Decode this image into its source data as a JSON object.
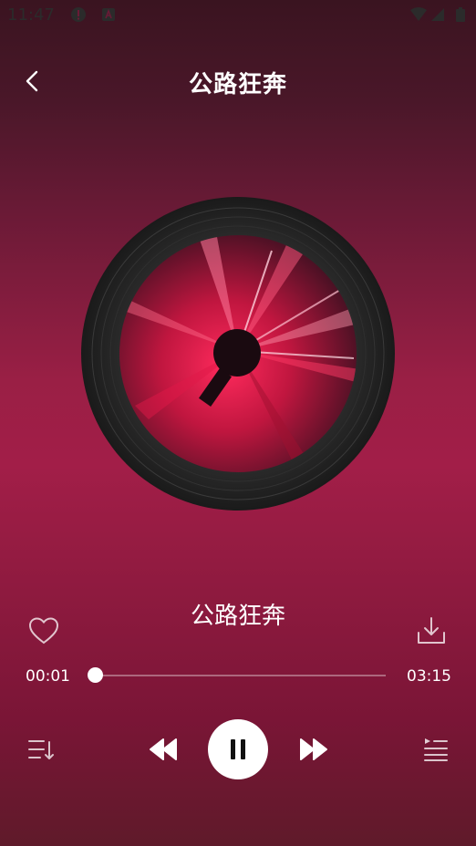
{
  "status_bar": {
    "time": "11:47"
  },
  "header": {
    "title": "公路狂奔"
  },
  "player": {
    "song_title": "公路狂奔",
    "current_time": "00:01",
    "total_time": "03:15",
    "progress": 0.01
  },
  "colors": {
    "accent": "#a21e48",
    "background_top": "#3a1420",
    "background_bottom": "#5f1a2a",
    "play_button": "#ffffff"
  },
  "icons": {
    "back": "chevron-left-icon",
    "like": "heart-outline-icon",
    "download": "download-icon",
    "playlist_sort": "playlist-sort-icon",
    "previous": "rewind-icon",
    "play_pause": "pause-icon",
    "next": "fast-forward-icon",
    "queue": "queue-list-icon"
  }
}
